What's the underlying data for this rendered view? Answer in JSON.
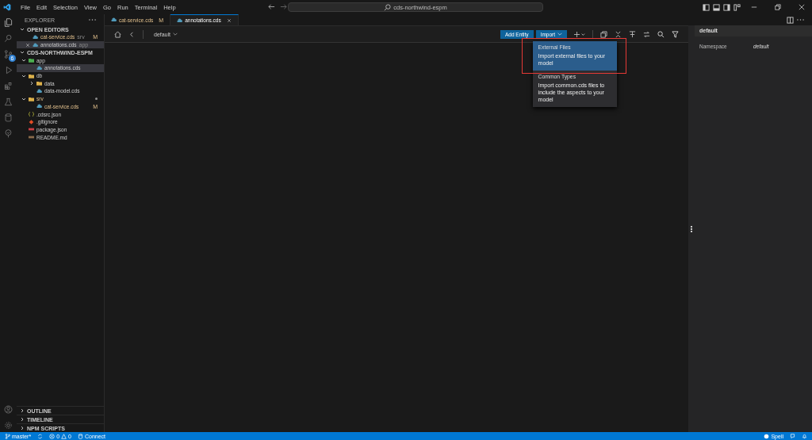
{
  "menu_bar": [
    "File",
    "Edit",
    "Selection",
    "View",
    "Go",
    "Run",
    "Terminal",
    "Help"
  ],
  "command_center": {
    "value": "cds-northwind-espm"
  },
  "activity_bar": {
    "source_control_badge": "6"
  },
  "sidebar": {
    "title": "EXPLORER",
    "open_editors": {
      "title": "OPEN EDITORS",
      "expanded": true,
      "items": [
        {
          "name": "cat-service.cds",
          "folder": "srv",
          "badge": "M",
          "selected": false
        },
        {
          "name": "annotations.cds",
          "folder": "app",
          "selected": true
        }
      ]
    },
    "workspace": {
      "title": "CDS-NORTHWIND-ESPM",
      "expanded": true,
      "tree": [
        {
          "name": "app",
          "kind": "folder",
          "expanded": true,
          "selected": false,
          "children": [
            {
              "name": "annotations.cds",
              "kind": "cds",
              "selected": true
            }
          ]
        },
        {
          "name": "db",
          "kind": "folder",
          "expanded": true,
          "selected": false,
          "children": [
            {
              "name": "data",
              "kind": "folder",
              "expanded": false,
              "selected": false
            },
            {
              "name": "data-model.cds",
              "kind": "cds",
              "selected": false
            }
          ]
        },
        {
          "name": "srv",
          "kind": "folder",
          "expanded": true,
          "selected": false,
          "modified": true,
          "children": [
            {
              "name": "cat-service.cds",
              "kind": "cds",
              "selected": false,
              "badge": "M"
            }
          ]
        },
        {
          "name": ".cdsrc.json",
          "kind": "json",
          "selected": false
        },
        {
          "name": ".gitignore",
          "kind": "git",
          "selected": false
        },
        {
          "name": "package.json",
          "kind": "npm",
          "selected": false
        },
        {
          "name": "README.md",
          "kind": "md",
          "selected": false
        }
      ]
    },
    "sections": [
      {
        "title": "OUTLINE",
        "expanded": false
      },
      {
        "title": "TIMELINE",
        "expanded": false
      },
      {
        "title": "NPM SCRIPTS",
        "expanded": false
      }
    ]
  },
  "tabs": [
    {
      "label": "cat-service.cds",
      "badge": "M",
      "selected": false
    },
    {
      "label": "annotations.cds",
      "selected": true
    }
  ],
  "editor_toolbar": {
    "namespace": "default",
    "add_button": "Add Entity",
    "import_button": "Import"
  },
  "import_menu": [
    {
      "title": "External Files",
      "description": "Import external files to your model",
      "selected": true,
      "highlighted": true
    },
    {
      "title": "Common Types",
      "description": "Import common.cds files to include the aspects to your model",
      "selected": false,
      "highlighted": false
    }
  ],
  "details_panel": {
    "title": "default",
    "fields": [
      {
        "label": "Namespace",
        "value": "default"
      }
    ]
  },
  "status_bar": {
    "branch": "master*",
    "errors": "0",
    "warnings": "0",
    "connect": "Connect",
    "spell": "Spell"
  }
}
